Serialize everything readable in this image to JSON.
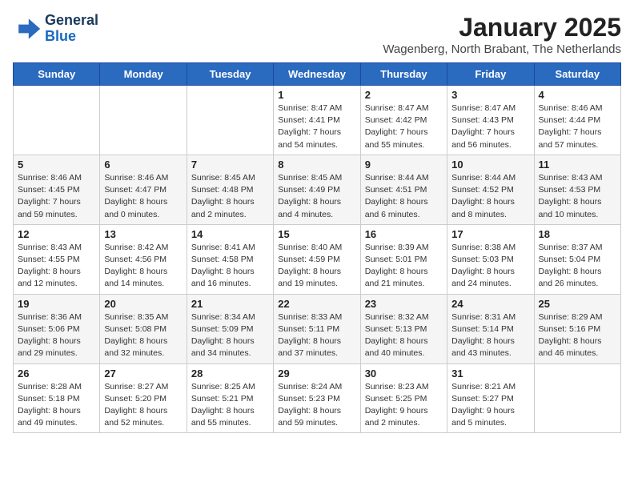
{
  "logo": {
    "line1": "General",
    "line2": "Blue"
  },
  "title": "January 2025",
  "subtitle": "Wagenberg, North Brabant, The Netherlands",
  "header_days": [
    "Sunday",
    "Monday",
    "Tuesday",
    "Wednesday",
    "Thursday",
    "Friday",
    "Saturday"
  ],
  "weeks": [
    [
      {
        "day": "",
        "info": ""
      },
      {
        "day": "",
        "info": ""
      },
      {
        "day": "",
        "info": ""
      },
      {
        "day": "1",
        "info": "Sunrise: 8:47 AM\nSunset: 4:41 PM\nDaylight: 7 hours\nand 54 minutes."
      },
      {
        "day": "2",
        "info": "Sunrise: 8:47 AM\nSunset: 4:42 PM\nDaylight: 7 hours\nand 55 minutes."
      },
      {
        "day": "3",
        "info": "Sunrise: 8:47 AM\nSunset: 4:43 PM\nDaylight: 7 hours\nand 56 minutes."
      },
      {
        "day": "4",
        "info": "Sunrise: 8:46 AM\nSunset: 4:44 PM\nDaylight: 7 hours\nand 57 minutes."
      }
    ],
    [
      {
        "day": "5",
        "info": "Sunrise: 8:46 AM\nSunset: 4:45 PM\nDaylight: 7 hours\nand 59 minutes."
      },
      {
        "day": "6",
        "info": "Sunrise: 8:46 AM\nSunset: 4:47 PM\nDaylight: 8 hours\nand 0 minutes."
      },
      {
        "day": "7",
        "info": "Sunrise: 8:45 AM\nSunset: 4:48 PM\nDaylight: 8 hours\nand 2 minutes."
      },
      {
        "day": "8",
        "info": "Sunrise: 8:45 AM\nSunset: 4:49 PM\nDaylight: 8 hours\nand 4 minutes."
      },
      {
        "day": "9",
        "info": "Sunrise: 8:44 AM\nSunset: 4:51 PM\nDaylight: 8 hours\nand 6 minutes."
      },
      {
        "day": "10",
        "info": "Sunrise: 8:44 AM\nSunset: 4:52 PM\nDaylight: 8 hours\nand 8 minutes."
      },
      {
        "day": "11",
        "info": "Sunrise: 8:43 AM\nSunset: 4:53 PM\nDaylight: 8 hours\nand 10 minutes."
      }
    ],
    [
      {
        "day": "12",
        "info": "Sunrise: 8:43 AM\nSunset: 4:55 PM\nDaylight: 8 hours\nand 12 minutes."
      },
      {
        "day": "13",
        "info": "Sunrise: 8:42 AM\nSunset: 4:56 PM\nDaylight: 8 hours\nand 14 minutes."
      },
      {
        "day": "14",
        "info": "Sunrise: 8:41 AM\nSunset: 4:58 PM\nDaylight: 8 hours\nand 16 minutes."
      },
      {
        "day": "15",
        "info": "Sunrise: 8:40 AM\nSunset: 4:59 PM\nDaylight: 8 hours\nand 19 minutes."
      },
      {
        "day": "16",
        "info": "Sunrise: 8:39 AM\nSunset: 5:01 PM\nDaylight: 8 hours\nand 21 minutes."
      },
      {
        "day": "17",
        "info": "Sunrise: 8:38 AM\nSunset: 5:03 PM\nDaylight: 8 hours\nand 24 minutes."
      },
      {
        "day": "18",
        "info": "Sunrise: 8:37 AM\nSunset: 5:04 PM\nDaylight: 8 hours\nand 26 minutes."
      }
    ],
    [
      {
        "day": "19",
        "info": "Sunrise: 8:36 AM\nSunset: 5:06 PM\nDaylight: 8 hours\nand 29 minutes."
      },
      {
        "day": "20",
        "info": "Sunrise: 8:35 AM\nSunset: 5:08 PM\nDaylight: 8 hours\nand 32 minutes."
      },
      {
        "day": "21",
        "info": "Sunrise: 8:34 AM\nSunset: 5:09 PM\nDaylight: 8 hours\nand 34 minutes."
      },
      {
        "day": "22",
        "info": "Sunrise: 8:33 AM\nSunset: 5:11 PM\nDaylight: 8 hours\nand 37 minutes."
      },
      {
        "day": "23",
        "info": "Sunrise: 8:32 AM\nSunset: 5:13 PM\nDaylight: 8 hours\nand 40 minutes."
      },
      {
        "day": "24",
        "info": "Sunrise: 8:31 AM\nSunset: 5:14 PM\nDaylight: 8 hours\nand 43 minutes."
      },
      {
        "day": "25",
        "info": "Sunrise: 8:29 AM\nSunset: 5:16 PM\nDaylight: 8 hours\nand 46 minutes."
      }
    ],
    [
      {
        "day": "26",
        "info": "Sunrise: 8:28 AM\nSunset: 5:18 PM\nDaylight: 8 hours\nand 49 minutes."
      },
      {
        "day": "27",
        "info": "Sunrise: 8:27 AM\nSunset: 5:20 PM\nDaylight: 8 hours\nand 52 minutes."
      },
      {
        "day": "28",
        "info": "Sunrise: 8:25 AM\nSunset: 5:21 PM\nDaylight: 8 hours\nand 55 minutes."
      },
      {
        "day": "29",
        "info": "Sunrise: 8:24 AM\nSunset: 5:23 PM\nDaylight: 8 hours\nand 59 minutes."
      },
      {
        "day": "30",
        "info": "Sunrise: 8:23 AM\nSunset: 5:25 PM\nDaylight: 9 hours\nand 2 minutes."
      },
      {
        "day": "31",
        "info": "Sunrise: 8:21 AM\nSunset: 5:27 PM\nDaylight: 9 hours\nand 5 minutes."
      },
      {
        "day": "",
        "info": ""
      }
    ]
  ]
}
